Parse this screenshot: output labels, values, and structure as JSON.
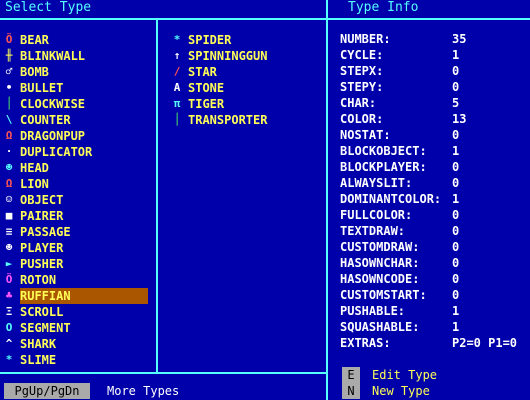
{
  "left_title": "Select Type",
  "right_title": "Type Info",
  "types_col1": [
    {
      "icon": "bear-icon",
      "glyph": "Ö",
      "color": "#ff5555",
      "name": "BEAR"
    },
    {
      "icon": "blinkwall-icon",
      "glyph": "╫",
      "color": "#ffff55",
      "name": "BLINKWALL"
    },
    {
      "icon": "bomb-icon",
      "glyph": "♂",
      "color": "#ffffff",
      "name": "BOMB"
    },
    {
      "icon": "bullet-icon",
      "glyph": "•",
      "color": "#ffffff",
      "name": "BULLET"
    },
    {
      "icon": "clockwise-icon",
      "glyph": "│",
      "color": "#55ff55",
      "name": "CLOCKWISE"
    },
    {
      "icon": "counter-icon",
      "glyph": "\\",
      "color": "#55ffff",
      "name": "COUNTER"
    },
    {
      "icon": "dragonpup-icon",
      "glyph": "Ω",
      "color": "#ff5555",
      "name": "DRAGONPUP"
    },
    {
      "icon": "duplicator-icon",
      "glyph": "·",
      "color": "#ffffff",
      "name": "DUPLICATOR"
    },
    {
      "icon": "head-icon",
      "glyph": "☻",
      "color": "#55ffff",
      "name": "HEAD"
    },
    {
      "icon": "lion-icon",
      "glyph": "Ω",
      "color": "#ff5555",
      "name": "LION"
    },
    {
      "icon": "object-icon",
      "glyph": "☺",
      "color": "#ffffff",
      "name": "OBJECT"
    },
    {
      "icon": "pairer-icon",
      "glyph": "■",
      "color": "#ffffff",
      "name": "PAIRER"
    },
    {
      "icon": "passage-icon",
      "glyph": "≡",
      "color": "#ffffff",
      "name": "PASSAGE"
    },
    {
      "icon": "player-icon",
      "glyph": "☻",
      "color": "#ffffff",
      "name": "PLAYER"
    },
    {
      "icon": "pusher-icon",
      "glyph": "►",
      "color": "#55ffff",
      "name": "PUSHER"
    },
    {
      "icon": "roton-icon",
      "glyph": "Ö",
      "color": "#ff55ff",
      "name": "ROTON"
    },
    {
      "icon": "ruffian-icon",
      "glyph": "♣",
      "color": "#ff55ff",
      "name": "RUFFIAN"
    },
    {
      "icon": "scroll-icon",
      "glyph": "Ξ",
      "color": "#ffffff",
      "name": "SCROLL"
    },
    {
      "icon": "segment-icon",
      "glyph": "O",
      "color": "#55ffff",
      "name": "SEGMENT"
    },
    {
      "icon": "shark-icon",
      "glyph": "^",
      "color": "#ffffff",
      "name": "SHARK"
    },
    {
      "icon": "slime-icon",
      "glyph": "*",
      "color": "#55ffff",
      "name": "SLIME"
    }
  ],
  "types_col2": [
    {
      "icon": "spider-icon",
      "glyph": "*",
      "color": "#55ffff",
      "name": "SPIDER"
    },
    {
      "icon": "spinninggun-icon",
      "glyph": "↑",
      "color": "#ffffff",
      "name": "SPINNINGGUN"
    },
    {
      "icon": "star-icon",
      "glyph": "/",
      "color": "#ff5555",
      "name": "STAR"
    },
    {
      "icon": "stone-icon",
      "glyph": "A",
      "color": "#ffffff",
      "name": "STONE"
    },
    {
      "icon": "tiger-icon",
      "glyph": "π",
      "color": "#55ffff",
      "name": "TIGER"
    },
    {
      "icon": "transporter-icon",
      "glyph": "│",
      "color": "#55ff55",
      "name": "TRANSPORTER"
    }
  ],
  "selected_type": "RUFFIAN",
  "info": [
    {
      "key": "NUMBER:",
      "value": "35"
    },
    {
      "key": "CYCLE:",
      "value": "1"
    },
    {
      "key": "STEPX:",
      "value": "0"
    },
    {
      "key": "STEPY:",
      "value": "0"
    },
    {
      "key": "CHAR:",
      "value": "5"
    },
    {
      "key": "COLOR:",
      "value": "13"
    },
    {
      "key": "NOSTAT:",
      "value": "0"
    },
    {
      "key": "BLOCKOBJECT:",
      "value": "1"
    },
    {
      "key": "BLOCKPLAYER:",
      "value": "0"
    },
    {
      "key": "ALWAYSLIT:",
      "value": "0"
    },
    {
      "key": "DOMINANTCOLOR:",
      "value": "1"
    },
    {
      "key": "FULLCOLOR:",
      "value": "0"
    },
    {
      "key": "TEXTDRAW:",
      "value": "0"
    },
    {
      "key": "CUSTOMDRAW:",
      "value": "0"
    },
    {
      "key": "HASOWNCHAR:",
      "value": "0"
    },
    {
      "key": "HASOWNCODE:",
      "value": "0"
    },
    {
      "key": "CUSTOMSTART:",
      "value": "0"
    },
    {
      "key": "PUSHABLE:",
      "value": "1"
    },
    {
      "key": "SQUASHABLE:",
      "value": "1"
    },
    {
      "key": "EXTRAS:",
      "value": "P2=0 P1=0"
    }
  ],
  "footer": {
    "key_label": "PgUp/PgDn",
    "text": "More Types"
  },
  "commands": [
    {
      "key": "E",
      "label": "Edit Type"
    },
    {
      "key": "N",
      "label": "New  Type"
    }
  ]
}
